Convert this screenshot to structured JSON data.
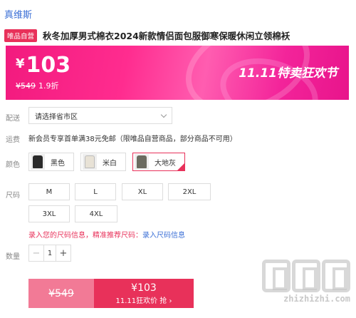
{
  "store": {
    "name": "真维斯"
  },
  "product": {
    "badge": "唯品自营",
    "title": "秋冬加厚男式棉衣2024新款情侣面包服御寒保暖休闲立领棉袄"
  },
  "banner": {
    "currency": "¥",
    "price": "103",
    "original_price": "¥549",
    "discount": "1.9折",
    "promo": "11.11特卖狂欢节"
  },
  "delivery": {
    "label": "配送",
    "select_value": "请选择省市区"
  },
  "shipping": {
    "label": "运费",
    "text": "新会员专享首单满38元免邮（限唯品自营商品，部分商品不可用）"
  },
  "colors": {
    "label": "颜色",
    "options": [
      {
        "name": "黑色",
        "swatch": "#2a2a2a",
        "selected": false
      },
      {
        "name": "米白",
        "swatch": "#e8e2d6",
        "selected": false
      },
      {
        "name": "大地灰",
        "swatch": "#6b6b60",
        "selected": true
      }
    ]
  },
  "sizes": {
    "label": "尺码",
    "options": [
      "M",
      "L",
      "XL",
      "2XL",
      "3XL",
      "4XL"
    ]
  },
  "size_hint": {
    "part1": "录入您的尺码信息，精准推荐尺码：",
    "link": "录入尺码信息"
  },
  "quantity": {
    "label": "数量",
    "value": "1",
    "minus": "−",
    "plus": "+"
  },
  "buy": {
    "original": "¥549",
    "price": "¥103",
    "action": "11.11狂欢价 抢 ›"
  },
  "watermark": {
    "text": "zhizhizhi.com"
  },
  "colors_theme": {
    "accent": "#e8315a",
    "link": "#3b6fd6"
  }
}
